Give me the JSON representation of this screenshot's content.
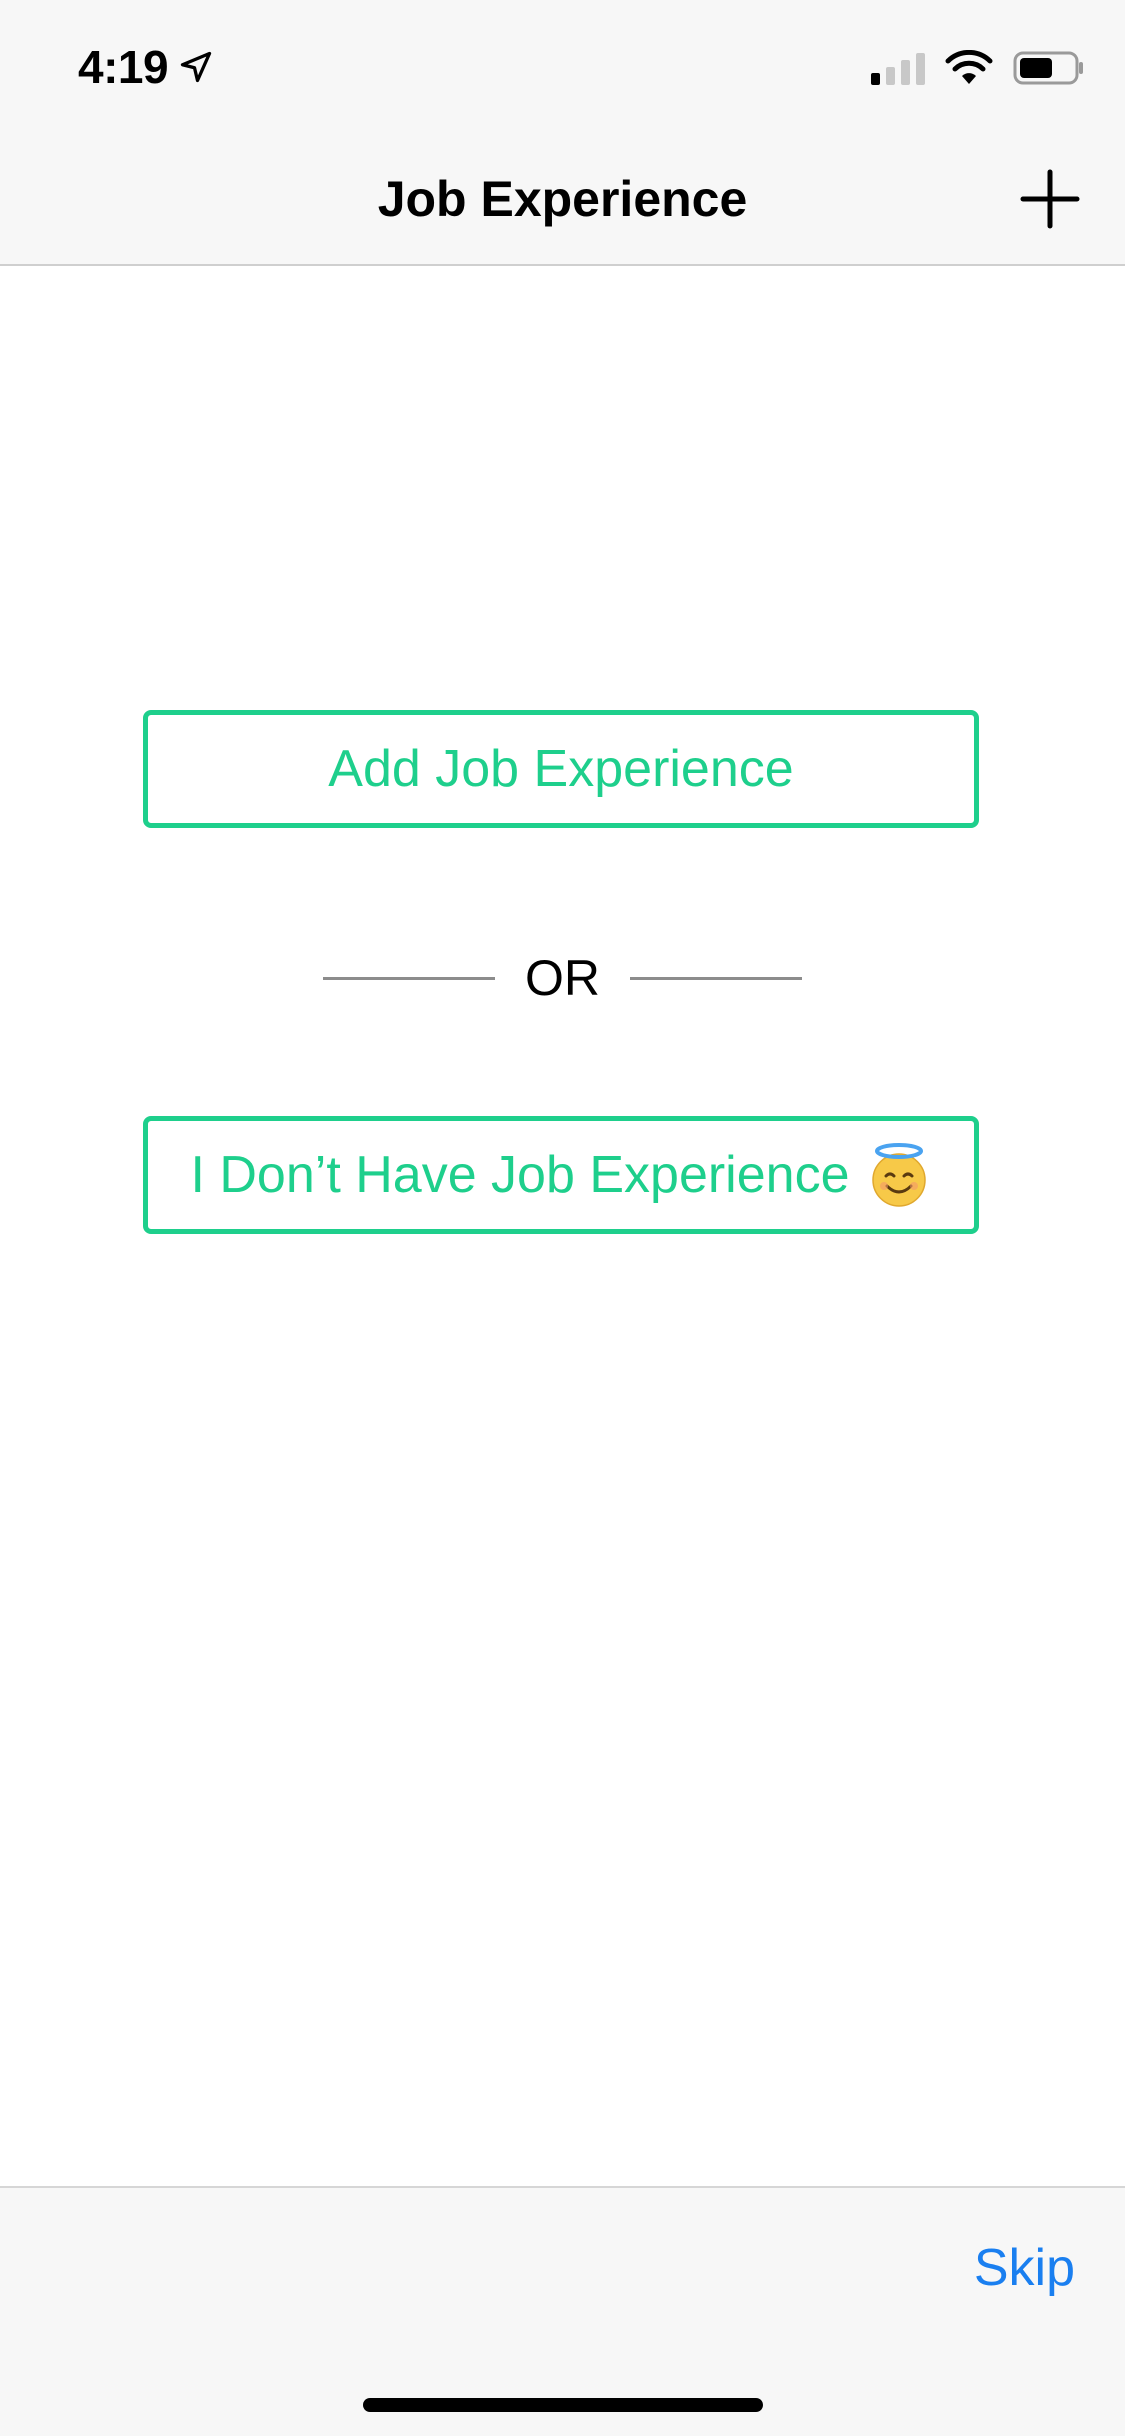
{
  "status_bar": {
    "time": "4:19",
    "location_icon": "location-arrow-icon",
    "signal_icon": "cellular-signal-icon",
    "wifi_icon": "wifi-icon",
    "battery_icon": "battery-icon"
  },
  "nav": {
    "title": "Job Experience",
    "add_icon": "plus-icon"
  },
  "main": {
    "add_button_label": "Add Job Experience",
    "separator_text": "OR",
    "no_experience_label": "I Don’t Have Job Experience",
    "no_experience_emoji_icon": "smiling-face-with-halo-icon"
  },
  "bottom_bar": {
    "skip_label": "Skip"
  },
  "colors": {
    "accent_green": "#1ecf8c",
    "link_blue": "#1a7ff0",
    "bar_background": "#f7f7f7"
  }
}
